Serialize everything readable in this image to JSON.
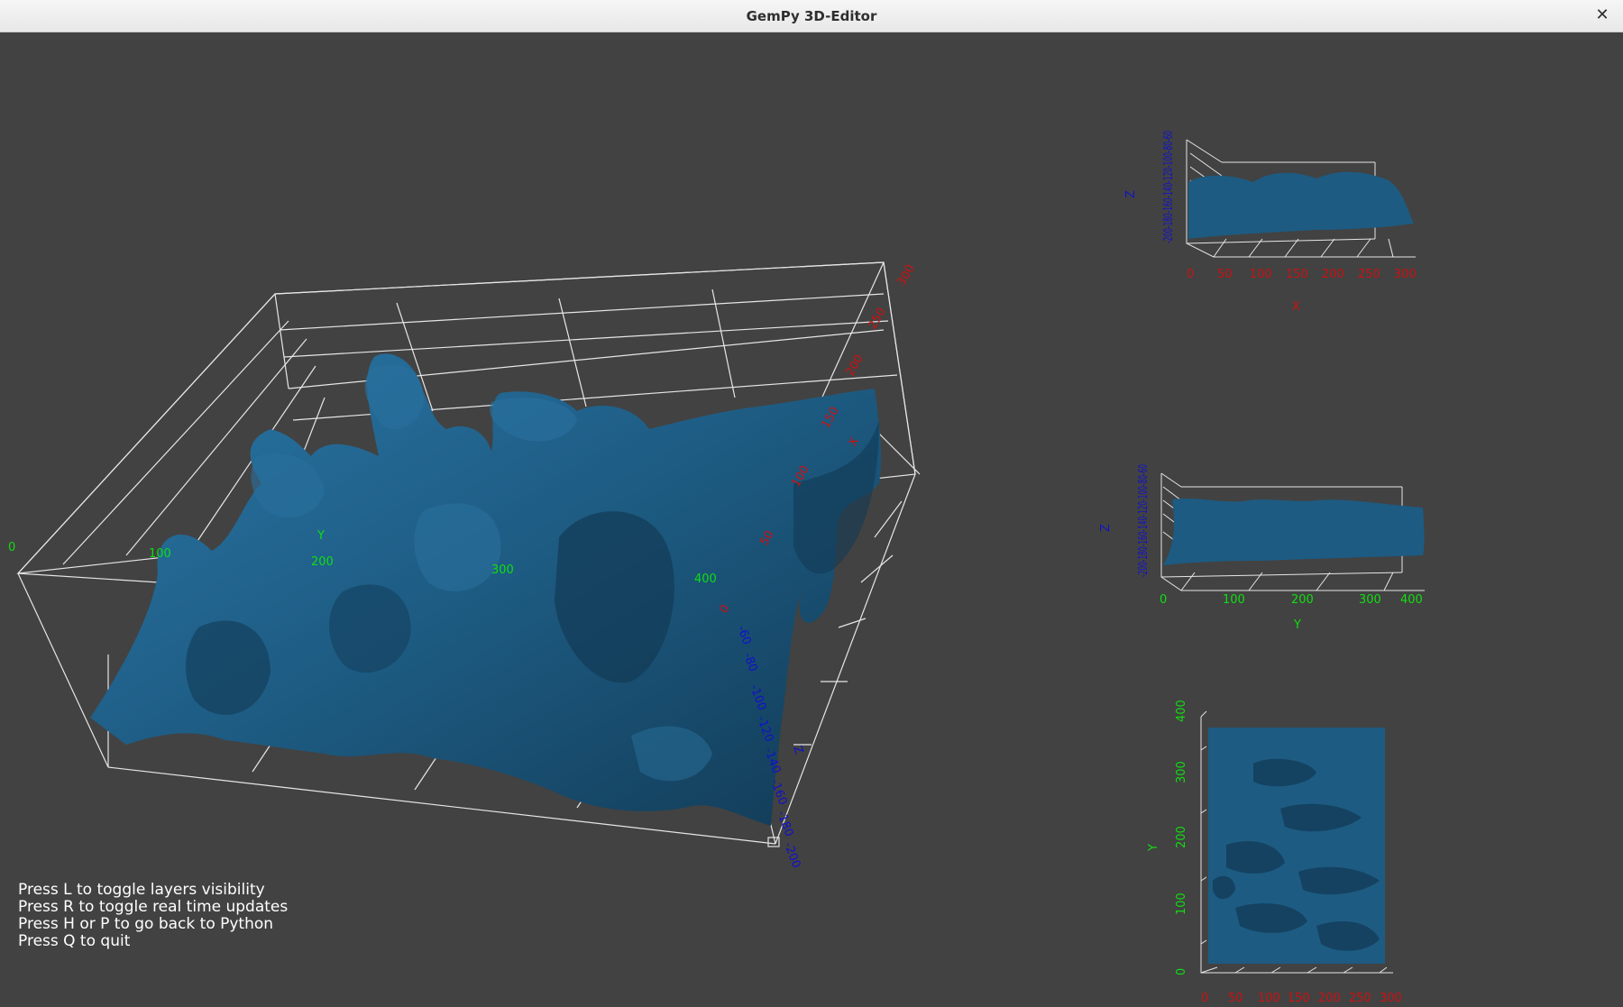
{
  "window": {
    "title": "GemPy 3D-Editor",
    "close_glyph": "✕"
  },
  "colors": {
    "background": "#424242",
    "surface": "#1d5b82",
    "grid": "#e6e6e6",
    "x_axis": "#cc1111",
    "y_axis": "#11dd11",
    "z_axis": "#1111cc",
    "help_text": "#ffffff"
  },
  "main_view": {
    "y_ticks": [
      "0",
      "100",
      "200",
      "300",
      "400"
    ],
    "y_label": "Y",
    "x_ticks": [
      "0",
      "50",
      "100",
      "150",
      "200",
      "250",
      "300"
    ],
    "x_label": "X",
    "z_ticks": [
      "-200",
      "-180",
      "-160",
      "-140",
      "-120",
      "-100",
      "-80",
      "-60"
    ],
    "z_label": "Z"
  },
  "side_view_x": {
    "x_ticks": [
      "0",
      "50",
      "100",
      "150",
      "200",
      "250",
      "300"
    ],
    "x_label": "X",
    "z_ticks": "-200-180-160-140-120-100-80-60",
    "z_label": "Z"
  },
  "side_view_y": {
    "y_ticks": [
      "0",
      "100",
      "200",
      "300",
      "400"
    ],
    "y_label": "Y",
    "z_ticks": "-200-180-160-140-120-100-80-60",
    "z_label": "Z"
  },
  "top_view": {
    "x_ticks": [
      "0",
      "50",
      "100",
      "150",
      "200",
      "250",
      "300"
    ],
    "y_ticks": [
      "0",
      "100",
      "200",
      "300",
      "400"
    ],
    "y_label": "Y"
  },
  "help": [
    "Press L to toggle layers visibility",
    "Press R to toggle real time updates",
    "Press H or P to go back to Python",
    "Press Q to quit"
  ]
}
